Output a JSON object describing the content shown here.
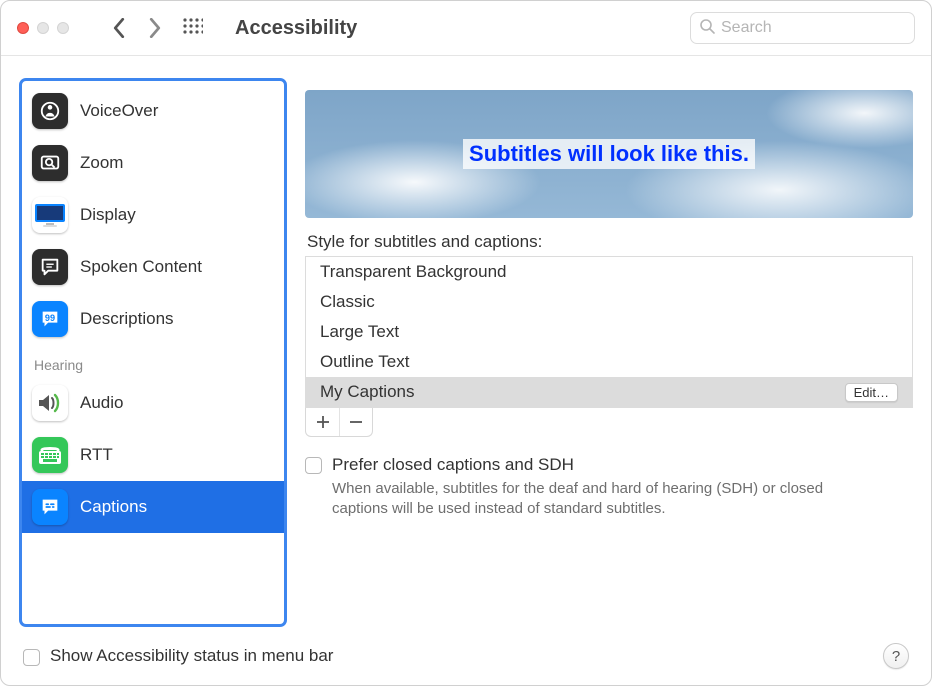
{
  "window": {
    "title": "Accessibility",
    "search_placeholder": "Search"
  },
  "sidebar": {
    "section_header": "Hearing",
    "items": [
      {
        "label": "VoiceOver",
        "icon": "voiceover-icon"
      },
      {
        "label": "Zoom",
        "icon": "zoom-icon"
      },
      {
        "label": "Display",
        "icon": "display-icon"
      },
      {
        "label": "Spoken Content",
        "icon": "spoken-content-icon"
      },
      {
        "label": "Descriptions",
        "icon": "descriptions-icon"
      }
    ],
    "hearing_items": [
      {
        "label": "Audio",
        "icon": "audio-icon"
      },
      {
        "label": "RTT",
        "icon": "rtt-icon"
      },
      {
        "label": "Captions",
        "icon": "captions-icon",
        "selected": true
      }
    ]
  },
  "main": {
    "preview_caption": "Subtitles will look like this.",
    "style_label": "Style for subtitles and captions:",
    "styles": [
      {
        "name": "Transparent Background"
      },
      {
        "name": "Classic"
      },
      {
        "name": "Large Text"
      },
      {
        "name": "Outline Text"
      },
      {
        "name": "My Captions",
        "selected": true,
        "edit_label": "Edit…"
      }
    ],
    "prefer_cc_label": "Prefer closed captions and SDH",
    "prefer_cc_desc": "When available, subtitles for the deaf and hard of hearing (SDH) or closed captions will be used instead of standard subtitles."
  },
  "footer": {
    "show_status_label": "Show Accessibility status in menu bar"
  }
}
